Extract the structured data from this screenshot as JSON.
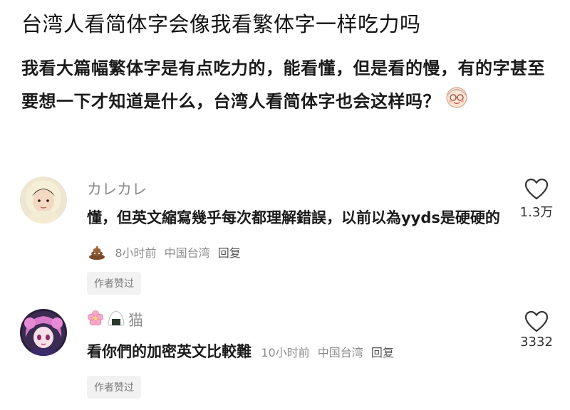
{
  "post": {
    "title": "台湾人看简体字会像我看繁体字一样吃力吗",
    "body": "我看大篇幅繁体字是有点吃力的，能看懂，但是看的慢，有的字甚至要想一下才知道是什么，台湾人看简体字也会这样吗？"
  },
  "comments": [
    {
      "username": "カレカレ",
      "text": "懂，但英文縮寫幾乎每次都理解錯誤，以前以為yyds是硬硬的",
      "time": "8小时前",
      "location": "中国台湾",
      "reply_label": "回复",
      "author_liked": "作者赞过",
      "like_count": "1.3万"
    },
    {
      "username": "猫",
      "text": "看你們的加密英文比較難",
      "time": "10小时前",
      "location": "中国台湾",
      "reply_label": "回复",
      "author_liked": "作者赞过",
      "like_count": "3332"
    }
  ],
  "colors": {
    "text": "#1a1a1a",
    "muted": "#8c8c8c",
    "badge_bg": "#f2f2f2"
  },
  "icons": [
    "heart-icon",
    "poop-emoji-icon",
    "cherry-blossom-icon",
    "rice-ball-icon",
    "grandma-emoji-icon"
  ]
}
